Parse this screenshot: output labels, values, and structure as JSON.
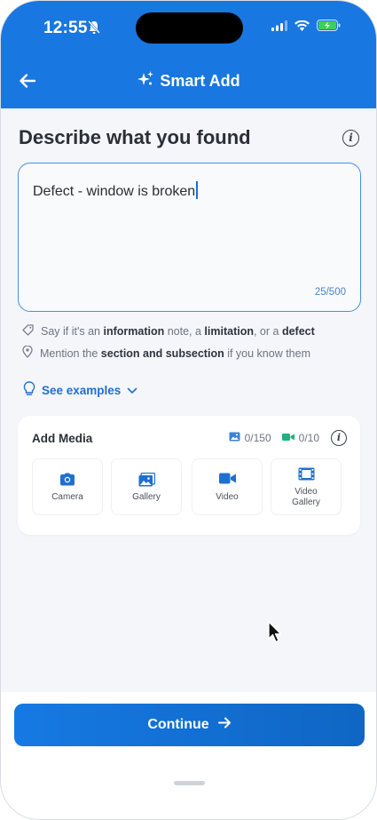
{
  "status_bar": {
    "time": "12:55",
    "battery_color": "#3ccf5a"
  },
  "app_bar": {
    "title": "Smart Add",
    "background": "#1877e1"
  },
  "heading": "Describe what you found",
  "description": {
    "value": "Defect - window is broken",
    "counter": "25/500"
  },
  "hints": {
    "h1": {
      "t1": "Say if it's an ",
      "b1": "information",
      "t2": " note, a ",
      "b2": "limitation",
      "t3": ", or a ",
      "b3": "defect"
    },
    "h2": {
      "t1": "Mention the ",
      "b1": "section and subsection",
      "t2": " if you know them"
    }
  },
  "see_examples": "See examples",
  "media": {
    "title": "Add Media",
    "photo_count": "0/150",
    "video_count": "0/10",
    "buttons": [
      "Camera",
      "Gallery",
      "Video",
      "Video Gallery"
    ]
  },
  "continue_label": "Continue",
  "accent": "#1877e1"
}
